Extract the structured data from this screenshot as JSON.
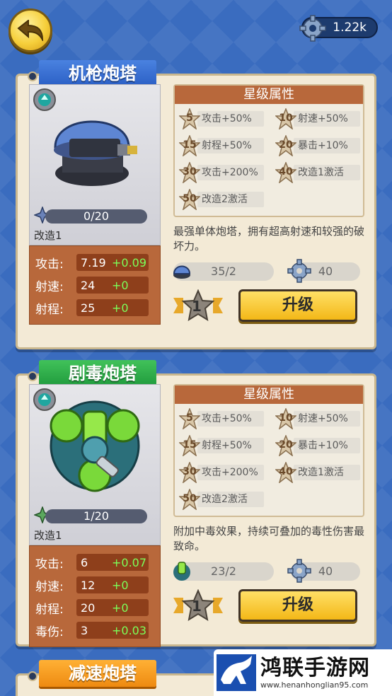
{
  "top": {
    "currency": "1.22k"
  },
  "cards": [
    {
      "title": "机枪炮塔",
      "progress": "0/20",
      "mod_label": "改造1",
      "stats": [
        {
          "label": "攻击:",
          "base": "7.19",
          "bonus": "+0.09"
        },
        {
          "label": "射速:",
          "base": "24",
          "bonus": "+0"
        },
        {
          "label": "射程:",
          "base": "25",
          "bonus": "+0"
        }
      ],
      "attr_title": "星级属性",
      "attrs": [
        {
          "star": "5",
          "text": "攻击+50%"
        },
        {
          "star": "10",
          "text": "射速+50%"
        },
        {
          "star": "15",
          "text": "射程+50%"
        },
        {
          "star": "20",
          "text": "暴击+10%"
        },
        {
          "star": "30",
          "text": "攻击+200%"
        },
        {
          "star": "40",
          "text": "改造1激活"
        },
        {
          "star": "50",
          "text": "改造2激活"
        }
      ],
      "description": "最强单体炮塔，拥有超高射速和较强的破坏力。",
      "res_a": "35/2",
      "res_b": "40",
      "level": "1",
      "upgrade": "升级"
    },
    {
      "title": "剧毒炮塔",
      "progress": "1/20",
      "mod_label": "改造1",
      "stats": [
        {
          "label": "攻击:",
          "base": "6",
          "bonus": "+0.07"
        },
        {
          "label": "射速:",
          "base": "12",
          "bonus": "+0"
        },
        {
          "label": "射程:",
          "base": "20",
          "bonus": "+0"
        },
        {
          "label": "毒伤:",
          "base": "3",
          "bonus": "+0.03"
        }
      ],
      "attr_title": "星级属性",
      "attrs": [
        {
          "star": "5",
          "text": "攻击+50%"
        },
        {
          "star": "10",
          "text": "射速+50%"
        },
        {
          "star": "15",
          "text": "射程+50%"
        },
        {
          "star": "20",
          "text": "暴击+10%"
        },
        {
          "star": "30",
          "text": "攻击+200%"
        },
        {
          "star": "40",
          "text": "改造1激活"
        },
        {
          "star": "50",
          "text": "改造2激活"
        }
      ],
      "description": "附加中毒效果，持续可叠加的毒性伤害最致命。",
      "res_a": "23/2",
      "res_b": "40",
      "level": "1",
      "upgrade": "升级"
    },
    {
      "title": "减速炮塔"
    }
  ],
  "watermark": {
    "title": "鸿联手游网",
    "url": "www.henanhonglian95.com"
  }
}
